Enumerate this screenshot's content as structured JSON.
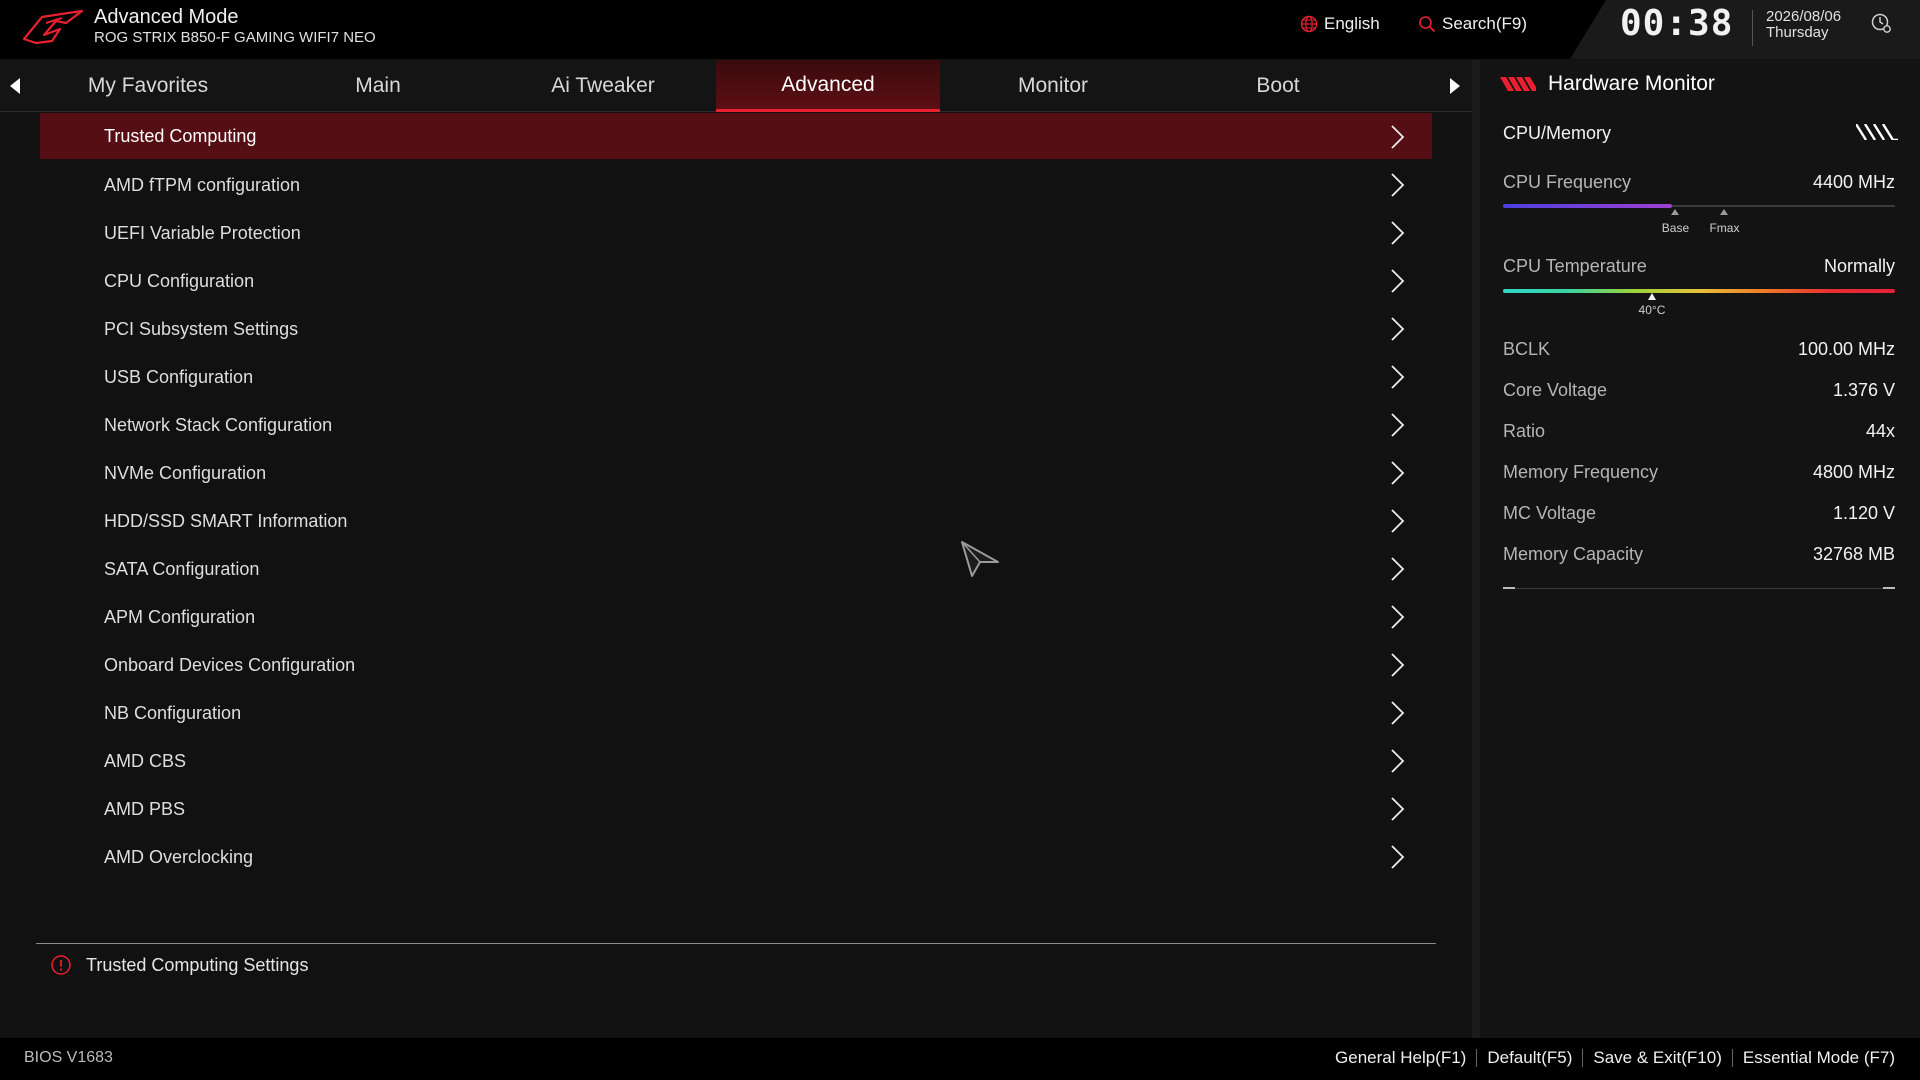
{
  "header": {
    "mode": "Advanced Mode",
    "board": "ROG STRIX B850-F GAMING WIFI7 NEO",
    "language": "English",
    "search": "Search(F9)",
    "clock": "00:38",
    "date": "2026/08/06",
    "weekday": "Thursday"
  },
  "tabs": [
    {
      "label": "My Favorites"
    },
    {
      "label": "Main"
    },
    {
      "label": "Ai Tweaker"
    },
    {
      "label": "Advanced",
      "active": true
    },
    {
      "label": "Monitor"
    },
    {
      "label": "Boot"
    }
  ],
  "menu": [
    "Trusted Computing",
    "AMD fTPM configuration",
    "UEFI Variable Protection",
    "CPU Configuration",
    "PCI Subsystem Settings",
    "USB Configuration",
    "Network Stack Configuration",
    "NVMe Configuration",
    "HDD/SSD SMART Information",
    "SATA Configuration",
    "APM Configuration",
    "Onboard Devices Configuration",
    "NB Configuration",
    "AMD CBS",
    "AMD PBS",
    "AMD Overclocking"
  ],
  "help_text": "Trusted Computing Settings",
  "hardware_monitor": {
    "title": "Hardware Monitor",
    "section": "CPU/Memory",
    "cpu_frequency": {
      "label": "CPU Frequency",
      "value": "4400 MHz",
      "level": 0.43,
      "base_marker": "Base",
      "base_pos": 0.44,
      "fmax_marker": "Fmax",
      "fmax_pos": 0.565
    },
    "cpu_temperature": {
      "label": "CPU Temperature",
      "value": "Normally",
      "marker": "40°C",
      "marker_pos": 0.38
    },
    "rows": [
      {
        "label": "BCLK",
        "value": "100.00 MHz"
      },
      {
        "label": "Core Voltage",
        "value": "1.376 V"
      },
      {
        "label": "Ratio",
        "value": "44x"
      },
      {
        "label": "Memory Frequency",
        "value": "4800 MHz"
      },
      {
        "label": "MC Voltage",
        "value": "1.120 V"
      },
      {
        "label": "Memory Capacity",
        "value": "32768 MB"
      }
    ]
  },
  "footer": {
    "bios_version": "BIOS V1683",
    "links": [
      "General Help(F1)",
      "Default(F5)",
      "Save & Exit(F10)",
      "Essential Mode (F7)"
    ]
  },
  "colors": {
    "accent": "#e8202f",
    "selected_row": "#550e13",
    "background": "#111111"
  }
}
